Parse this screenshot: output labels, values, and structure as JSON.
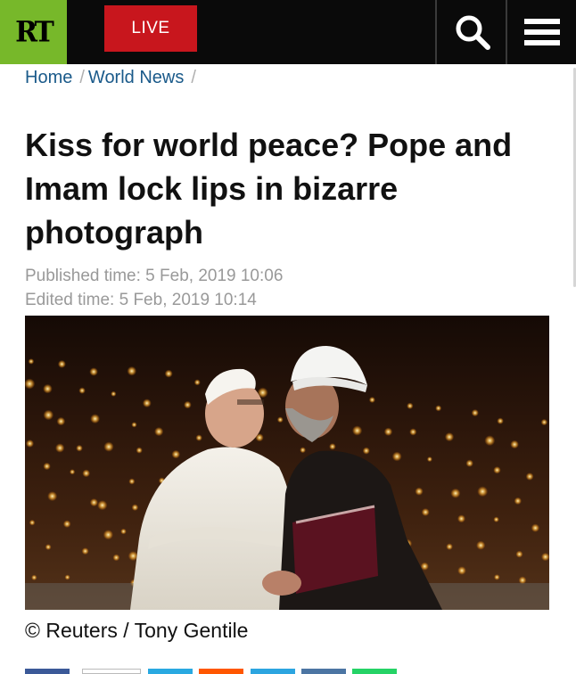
{
  "header": {
    "logo_text": "RT",
    "live_label": "LIVE",
    "colors": {
      "logo_bg": "#77b82a",
      "live_bg": "#c8161d",
      "bar_bg": "#0a0a0a"
    },
    "search_icon": "search-icon",
    "menu_icon": "hamburger-menu-icon"
  },
  "breadcrumb": {
    "items": [
      {
        "label": "Home"
      },
      {
        "label": "World News"
      }
    ]
  },
  "article": {
    "title": "Kiss for world peace? Pope and Imam lock lips in bizarre photograph",
    "published": "Published time: 5 Feb, 2019 10:06",
    "edited": "Edited time: 5 Feb, 2019 10:14",
    "photo_description_icon": "news-photo",
    "caption": "© Reuters / Tony Gentile"
  },
  "share_buttons": [
    {
      "name": "facebook",
      "color": "#3b5998"
    },
    {
      "name": "comments",
      "color": "#ffffff"
    },
    {
      "name": "twitter",
      "color": "#29a9e1"
    },
    {
      "name": "reddit",
      "color": "#ff5700"
    },
    {
      "name": "telegram",
      "color": "#2ca5e0"
    },
    {
      "name": "vk",
      "color": "#4c75a3"
    },
    {
      "name": "whatsapp",
      "color": "#25d366"
    }
  ]
}
